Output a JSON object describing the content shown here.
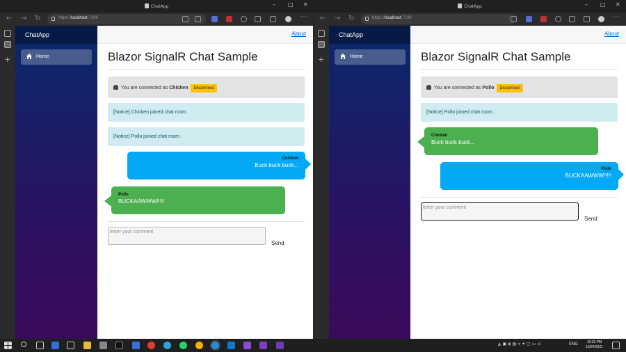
{
  "browser": {
    "tab_title": "ChatApp",
    "url_prefix": "https://",
    "url_host": "localhost",
    "url_port": ":7198"
  },
  "app": {
    "brand": "ChatApp",
    "nav_home": "Home",
    "about_link": "About",
    "heading": "Blazor SignalR Chat Sample",
    "connected_prefix": "You are connected as",
    "disconnect_label": "Disconnect",
    "comment_placeholder": "enter your comment",
    "send_label": "Send"
  },
  "left_window": {
    "user": "Chicken",
    "notices": [
      "[Notice] Chicken joined chat room.",
      "[Notice] Pollo joined chat room."
    ],
    "messages": [
      {
        "sender": "Chicken",
        "text": "Buck buck buck...",
        "direction": "outgoing"
      },
      {
        "sender": "Pollo",
        "text": "BUCKAAWWW!!!!!",
        "direction": "incoming"
      }
    ]
  },
  "right_window": {
    "user": "Pollo",
    "notices": [
      "[Notice] Pollo joined chat room."
    ],
    "messages": [
      {
        "sender": "Chicken",
        "text": "Buck buck buck...",
        "direction": "incoming"
      },
      {
        "sender": "Pollo",
        "text": "BUCKAAWWW!!!!!",
        "direction": "outgoing"
      }
    ]
  },
  "taskbar": {
    "time": "10:33 PM",
    "date": "10/24/2021",
    "lang": "ENG"
  },
  "colors": {
    "outgoing_bubble": "#03a9f4",
    "incoming_bubble": "#4caf50",
    "notice_bg": "#d1ecf1",
    "disconnect_button": "#ffc107",
    "about_link": "#0366d6"
  }
}
